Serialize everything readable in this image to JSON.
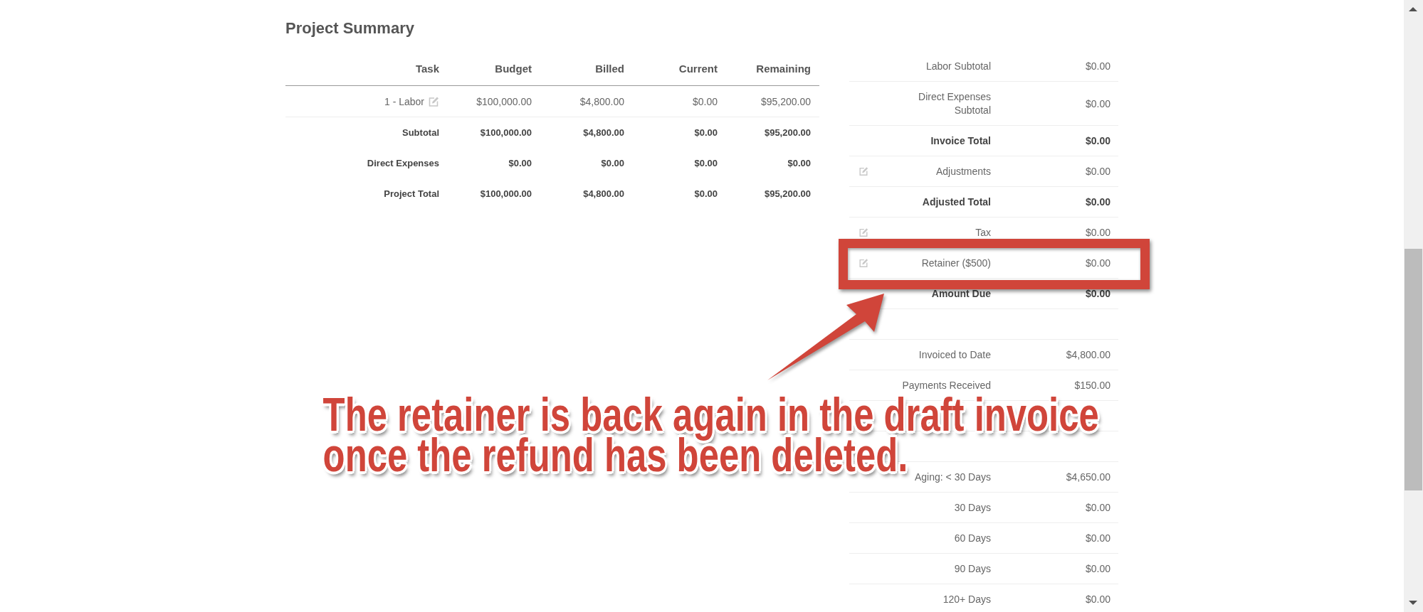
{
  "title": "Project Summary",
  "summary_table": {
    "columns": [
      "Task",
      "Budget",
      "Billed",
      "Current",
      "Remaining"
    ],
    "rows": [
      {
        "kind": "task",
        "editable": true,
        "cells": [
          "1 - Labor",
          "$100,000.00",
          "$4,800.00",
          "$0.00",
          "$95,200.00"
        ]
      },
      {
        "kind": "total",
        "editable": false,
        "cells": [
          "Subtotal",
          "$100,000.00",
          "$4,800.00",
          "$0.00",
          "$95,200.00"
        ]
      },
      {
        "kind": "total",
        "editable": false,
        "cells": [
          "Direct Expenses",
          "$0.00",
          "$0.00",
          "$0.00",
          "$0.00"
        ]
      },
      {
        "kind": "total",
        "editable": false,
        "cells": [
          "Project Total",
          "$100,000.00",
          "$4,800.00",
          "$0.00",
          "$95,200.00"
        ]
      }
    ]
  },
  "totals": [
    {
      "kind": "plain",
      "editable": false,
      "highlighted": false,
      "label": "Labor Subtotal",
      "value": "$0.00"
    },
    {
      "kind": "plain",
      "editable": false,
      "highlighted": false,
      "label": "Direct Expenses Subtotal",
      "value": "$0.00"
    },
    {
      "kind": "bold",
      "editable": false,
      "highlighted": false,
      "label": "Invoice Total",
      "value": "$0.00"
    },
    {
      "kind": "plain",
      "editable": true,
      "highlighted": false,
      "label": "Adjustments",
      "value": "$0.00"
    },
    {
      "kind": "bold",
      "editable": false,
      "highlighted": false,
      "label": "Adjusted Total",
      "value": "$0.00"
    },
    {
      "kind": "plain",
      "editable": true,
      "highlighted": false,
      "label": "Tax",
      "value": "$0.00"
    },
    {
      "kind": "plain",
      "editable": true,
      "highlighted": true,
      "label": "Retainer ($500)",
      "value": "$0.00"
    },
    {
      "kind": "bold",
      "editable": false,
      "highlighted": false,
      "label": "Amount Due",
      "value": "$0.00"
    },
    {
      "kind": "blank",
      "editable": false,
      "highlighted": false
    },
    {
      "kind": "plain",
      "editable": false,
      "highlighted": false,
      "label": "Invoiced to Date",
      "value": "$4,800.00"
    },
    {
      "kind": "plain",
      "editable": false,
      "highlighted": false,
      "label": "Payments Received",
      "value": "$150.00"
    },
    {
      "kind": "blank",
      "editable": false,
      "highlighted": false
    },
    {
      "kind": "blank",
      "editable": false,
      "highlighted": false
    },
    {
      "kind": "plain",
      "editable": false,
      "highlighted": false,
      "label": "Aging: < 30 Days",
      "value": "$4,650.00"
    },
    {
      "kind": "plain",
      "editable": false,
      "highlighted": false,
      "label": "30 Days",
      "value": "$0.00"
    },
    {
      "kind": "plain",
      "editable": false,
      "highlighted": false,
      "label": "60 Days",
      "value": "$0.00"
    },
    {
      "kind": "plain",
      "editable": false,
      "highlighted": false,
      "label": "90 Days",
      "value": "$0.00"
    },
    {
      "kind": "plain",
      "editable": false,
      "highlighted": false,
      "label": "120+ Days",
      "value": "$0.00"
    }
  ],
  "callout": {
    "lines": [
      "The retainer is back again in the draft invoice",
      "once the refund has been deleted."
    ]
  }
}
